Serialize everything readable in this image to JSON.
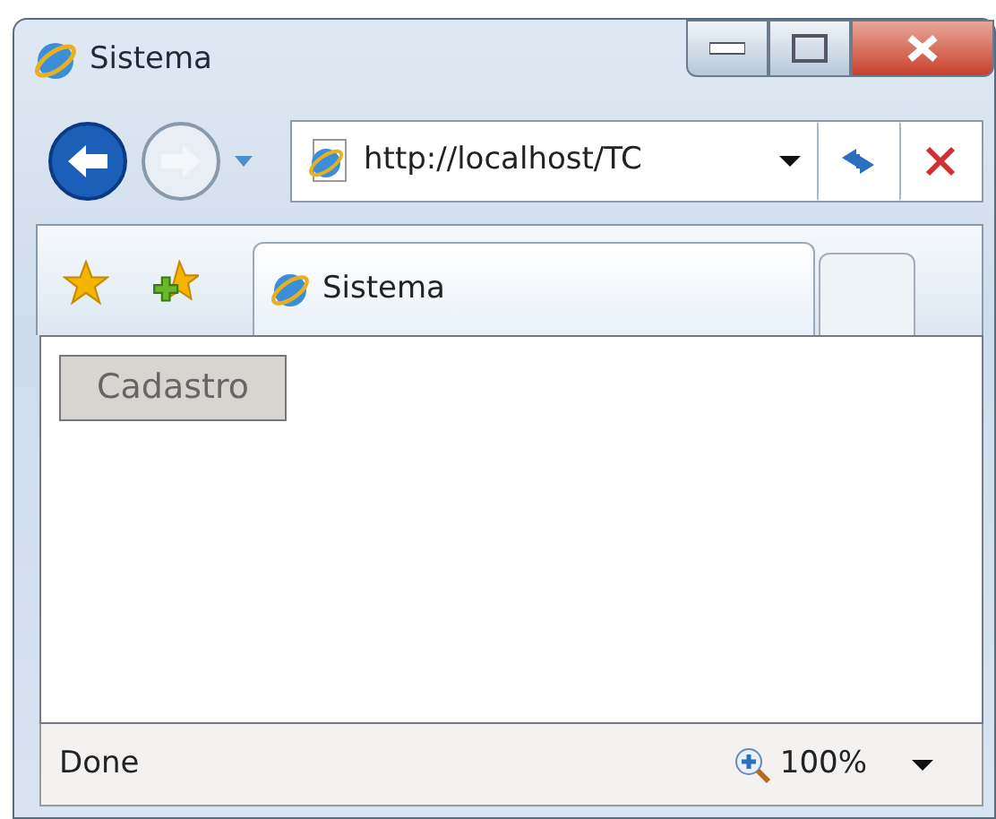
{
  "window": {
    "title": "Sistema"
  },
  "address_bar": {
    "value": "http://localhost/TC"
  },
  "tabs": [
    {
      "label": "Sistema",
      "selected": true
    }
  ],
  "content": {
    "buttons": [
      "Cadastro"
    ]
  },
  "status_bar": {
    "text": "Done",
    "zoom": "100%"
  }
}
